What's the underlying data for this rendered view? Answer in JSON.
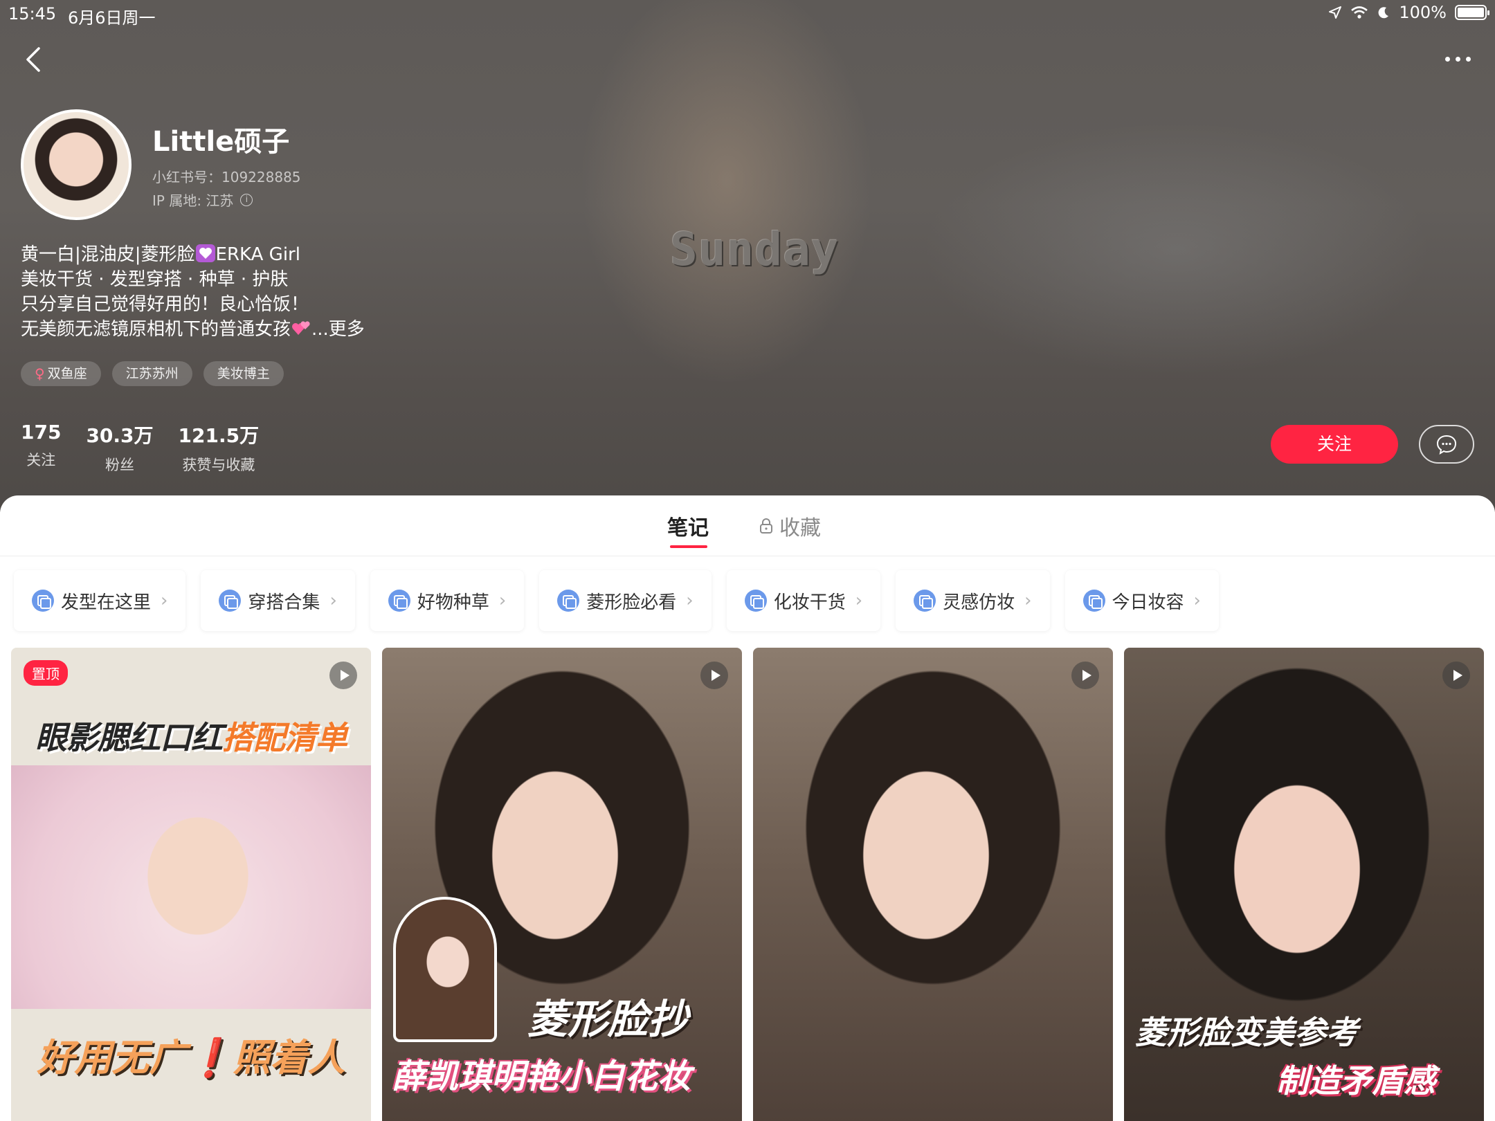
{
  "status_bar": {
    "time": "15:45",
    "date": "6月6日周一",
    "battery": "100%"
  },
  "profile": {
    "nickname": "Little硕子",
    "red_id": "小红书号：109228885",
    "ip": "IP 属地: 江苏",
    "bio": {
      "line1_a": "黄一白|混油皮|菱形脸",
      "line1_b": "ERKA Girl",
      "line2": "美妆干货 · 发型穿搭 · 种草 · 护肤",
      "line3": "只分享自己觉得好用的！良心恰饭！",
      "line4": "无美颜无滤镜原相机下的普通女孩",
      "more": "...更多"
    },
    "tags": [
      "双鱼座",
      "江苏苏州",
      "美妆博主"
    ],
    "stats": [
      {
        "num": "175",
        "label": "关注"
      },
      {
        "num": "30.3万",
        "label": "粉丝"
      },
      {
        "num": "121.5万",
        "label": "获赞与收藏"
      }
    ],
    "follow_label": "关注",
    "banner_text": "Sunday"
  },
  "tabs": {
    "notes": "笔记",
    "collect": "收藏"
  },
  "collections": [
    "发型在这里",
    "穿搭合集",
    "好物种草",
    "菱形脸必看",
    "化妆干货",
    "灵感仿妆",
    "今日妆容"
  ],
  "cards": {
    "card1": {
      "pin": "置顶",
      "title_a": "眼影腮红口红",
      "title_b": "搭配清单",
      "bottom_a": "好用无广",
      "bottom_ex": "❗",
      "bottom_b": "照着人"
    },
    "card2": {
      "t1": "菱形脸抄",
      "t2": "薛凯琪明艳小白花妆"
    },
    "card4": {
      "t1": "菱形脸变美参考",
      "t2": "制造矛盾感"
    }
  },
  "colors": {
    "accent": "#ff2442",
    "chip_icon": "#6b99ea"
  }
}
